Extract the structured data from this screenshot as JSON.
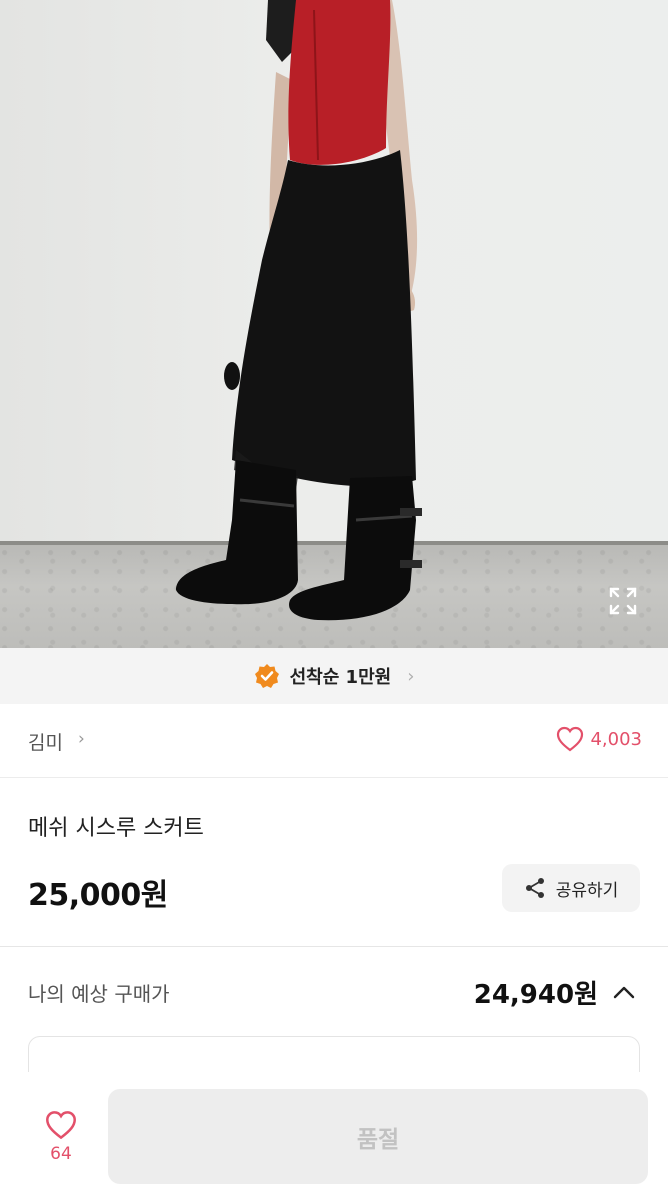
{
  "photo": {
    "alt": ""
  },
  "promo": {
    "text": "선착순 1만원",
    "badge_color": "#F08A1D",
    "chevron": "›"
  },
  "seller": {
    "name": "김미",
    "chevron": "›",
    "like_count": "4,003"
  },
  "product": {
    "title": "메쉬 시스루 스커트",
    "price": "25,000원"
  },
  "share": {
    "label": "공유하기",
    "icon": "share-icon"
  },
  "estimate": {
    "label": "나의 예상 구매가",
    "value": "24,940원",
    "toggle_icon": "chevron-up-icon"
  },
  "bottom": {
    "like_count": "64",
    "button_label": "품절"
  },
  "colors": {
    "accent_pink": "#E3506A",
    "badge_orange": "#F08A1D"
  }
}
